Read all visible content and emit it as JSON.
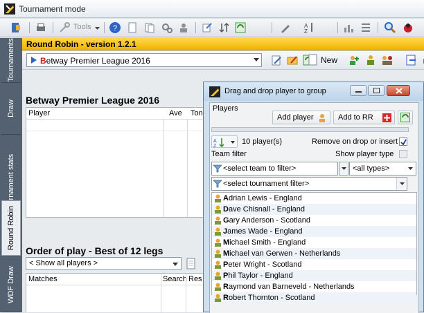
{
  "window": {
    "title": "Tournament mode"
  },
  "toolbar": {
    "tools_label": "Tools"
  },
  "side_tabs": [
    "Tournaments",
    "Draw",
    "Tournament stats",
    "Round Robin",
    "WDF Draw"
  ],
  "rr": {
    "title": "Round Robin - version 1.2.1",
    "league_initial": "B",
    "league_rest": "etway Premier League 2016",
    "new_label": "New"
  },
  "main": {
    "league_title": "Betway Premier League 2016",
    "player_columns": [
      "Player",
      "Ave",
      "Ton"
    ],
    "order_title": "Order of play - Best of 12 legs",
    "show_players": "< Show all players >",
    "match_columns": [
      "Matches",
      "Search",
      "Res"
    ]
  },
  "dialog": {
    "title": "Drag and drop player to group",
    "section": "Players",
    "add_player": "Add player",
    "add_to_rr": "Add to RR",
    "player_count": "10 player(s)",
    "remove_label": "Remove on drop or insert",
    "remove_checked": true,
    "team_filter_label": "Team filter",
    "show_type_label": "Show player type",
    "show_type_checked": false,
    "team_select": "<select team to filter>",
    "type_select": "<all types>",
    "tournament_select": "<select tournament filter>",
    "players": [
      {
        "initial": "A",
        "rest": "drian Lewis - England"
      },
      {
        "initial": "D",
        "rest": "ave Chisnall - England"
      },
      {
        "initial": "G",
        "rest": "ary Anderson - Scotland"
      },
      {
        "initial": "J",
        "rest": "ames Wade - England"
      },
      {
        "initial": "M",
        "rest": "ichael Smith - England"
      },
      {
        "initial": "M",
        "rest": "ichael van Gerwen - Netherlands"
      },
      {
        "initial": "P",
        "rest": "eter Wright - Scotland"
      },
      {
        "initial": "P",
        "rest": "hil Taylor - England"
      },
      {
        "initial": "R",
        "rest": "aymond van Barneveld - Netherlands"
      },
      {
        "initial": "R",
        "rest": "obert Thornton - Scotland"
      }
    ]
  }
}
